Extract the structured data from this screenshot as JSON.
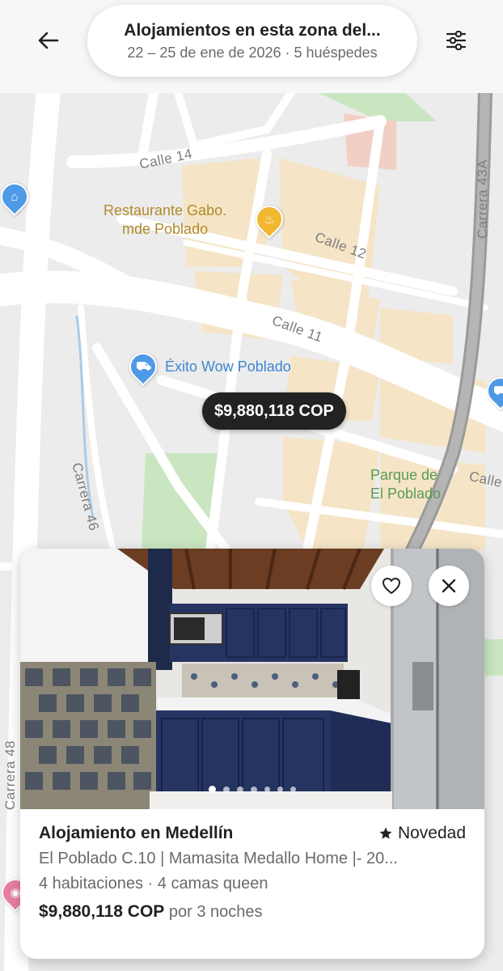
{
  "header": {
    "title": "Alojamientos en esta zona del...",
    "subtitle": "22 – 25 de ene de 2026 · 5 huéspedes",
    "back_icon": "arrow-left-icon",
    "filter_icon": "sliders-icon"
  },
  "map": {
    "streets": [
      "Calle 14",
      "Calle 12",
      "Calle 11",
      "Carrera 43A",
      "Carrera 46",
      "Carrera 48",
      "Calle"
    ],
    "pois": [
      {
        "name": "Restaurante Gabo.\nmde Poblado",
        "icon": "restaurant-icon"
      },
      {
        "name": "Éxito Wow Poblado",
        "icon": "shopping-cart-icon"
      },
      {
        "name": "Parque de\nEl Poblado",
        "icon": "park-icon"
      }
    ],
    "price_marker": "$9,880,118 COP",
    "colors": {
      "road": "#ffffff",
      "block": "#f5e5c6",
      "park": "#c9e6c1",
      "base": "#ececec",
      "major_road": "#9a9a9a"
    }
  },
  "listing": {
    "title": "Alojamiento en Medellín",
    "badge": "Novedad",
    "name": "El Poblado C.10 | Mamasita Medallo Home |- 20...",
    "rooms": "4 habitaciones · 4 camas queen",
    "price": "$9,880,118 COP",
    "price_suffix": "por 3 noches",
    "photo_count": 7,
    "active_photo": 0,
    "photo_description_icon": "kitchen-photo"
  }
}
